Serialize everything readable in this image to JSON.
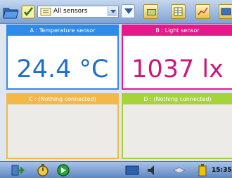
{
  "toolbar": {
    "sensor_select_value": "All sensors",
    "icons": [
      "folder-icon",
      "checklist-icon",
      "view-menu-icon",
      "table-icon",
      "grid-icon",
      "chart-icon",
      "monitor-icon"
    ]
  },
  "panels": [
    {
      "label": "A : Temperature sensor",
      "value": "24.4 °C",
      "color": "#2f8be8"
    },
    {
      "label": "B : Light sensor",
      "value": "1037 lx",
      "color": "#e6198c"
    },
    {
      "label": "C : (Nothing connected)",
      "value": "",
      "color": "#f2b94a"
    },
    {
      "label": "D : (Nothing connected)",
      "value": "",
      "color": "#a6d23a"
    }
  ],
  "statusbar": {
    "time": "15:35",
    "icons": [
      "exit-icon",
      "timer-icon",
      "play-icon",
      "screen-icon",
      "sound-icon",
      "device-icon",
      "battery-icon"
    ]
  }
}
